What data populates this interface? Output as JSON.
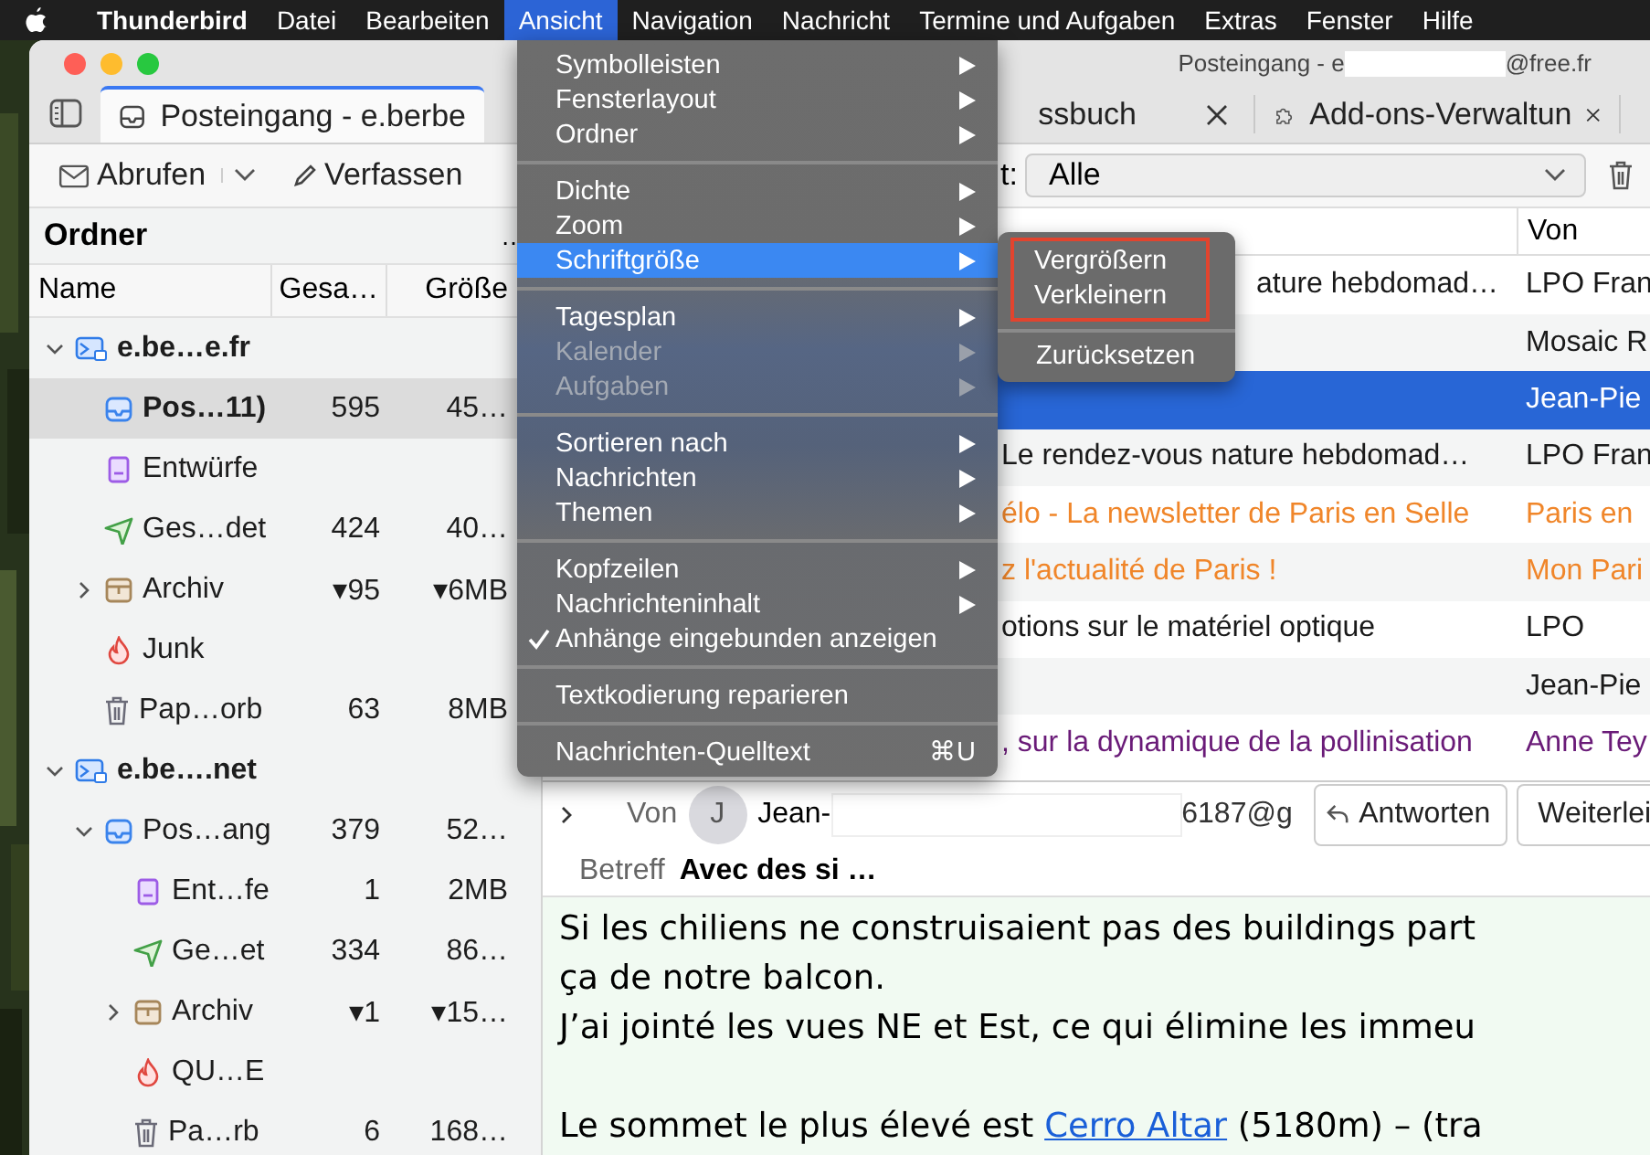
{
  "menubar": {
    "items": [
      {
        "label": "Thunderbird",
        "kind": "app",
        "selected": false
      },
      {
        "label": "Datei",
        "kind": "menu",
        "selected": false
      },
      {
        "label": "Bearbeiten",
        "kind": "menu",
        "selected": false
      },
      {
        "label": "Ansicht",
        "kind": "menu",
        "selected": true
      },
      {
        "label": "Navigation",
        "kind": "menu",
        "selected": false
      },
      {
        "label": "Nachricht",
        "kind": "menu",
        "selected": false
      },
      {
        "label": "Termine und Aufgaben",
        "kind": "menu",
        "selected": false
      },
      {
        "label": "Extras",
        "kind": "menu",
        "selected": false
      },
      {
        "label": "Fenster",
        "kind": "menu",
        "selected": false
      },
      {
        "label": "Hilfe",
        "kind": "menu",
        "selected": false
      }
    ]
  },
  "window": {
    "title_start": "Posteingang - e",
    "title_end": "@free.fr"
  },
  "tabs": [
    {
      "label": "Posteingang - e.berbe",
      "kind": "inbox",
      "selected": true,
      "closable": false
    },
    {
      "label": "ssbuch",
      "selected": false,
      "closable": true
    },
    {
      "label": "Add-ons-Verwaltun",
      "kind": "puzzle",
      "selected": false,
      "closable": true
    }
  ],
  "toolbar": {
    "get_messages": "Abrufen",
    "compose": "Verfassen",
    "filter_label": "t:",
    "filter_value": "Alle"
  },
  "folder_pane": {
    "title": "Ordner",
    "more": "…",
    "columns": [
      "Name",
      "Gesa…",
      "Größe"
    ],
    "folders": [
      {
        "name": "e.be…e.fr",
        "kind": "account",
        "bold": true,
        "selected": false,
        "expanded": true,
        "children": [
          {
            "name": "Pos…11)",
            "kind": "inbox",
            "total": "595",
            "size": "45…",
            "bold": true,
            "selected": true
          },
          {
            "name": "Entwürfe",
            "kind": "drafts",
            "bold": false,
            "selected": false
          },
          {
            "name": "Ges…det",
            "kind": "sent",
            "total": "424",
            "size": "40…",
            "bold": false,
            "selected": false
          },
          {
            "name": "Archiv",
            "kind": "archive",
            "total": "▾95",
            "size": "▾6MB",
            "bold": false,
            "selected": false,
            "expanded": false
          },
          {
            "name": "Junk",
            "kind": "junk",
            "bold": false,
            "selected": false
          },
          {
            "name": "Pap…orb",
            "kind": "trash",
            "total": "63",
            "size": "8MB",
            "bold": false,
            "selected": false
          }
        ]
      },
      {
        "name": "e.be….net",
        "kind": "account",
        "bold": true,
        "selected": false,
        "expanded": true,
        "children": [
          {
            "name": "Pos…ang",
            "kind": "inbox",
            "total": "379",
            "size": "52…",
            "bold": false,
            "selected": false,
            "expanded": true,
            "children": [
              {
                "name": "Ent…fe",
                "kind": "drafts",
                "total": "1",
                "size": "2MB",
                "bold": false,
                "selected": false
              },
              {
                "name": "Ge…et",
                "kind": "sent",
                "total": "334",
                "size": "86…",
                "bold": false,
                "selected": false
              },
              {
                "name": "Archiv",
                "kind": "archive",
                "total": "▾1",
                "size": "▾15…",
                "bold": false,
                "selected": false,
                "expanded": false
              },
              {
                "name": "QU…E",
                "kind": "junk",
                "bold": false,
                "selected": false
              },
              {
                "name": "Pa…rb",
                "kind": "trash",
                "total": "6",
                "size": "168…",
                "bold": false,
                "selected": false
              }
            ]
          }
        ]
      }
    ]
  },
  "message_list": {
    "columns": [
      "Von"
    ],
    "rows": [
      {
        "subject": "ature hebdomad…",
        "sender": "LPO Fran",
        "color": "#1a1a1a",
        "selected": false
      },
      {
        "sender": "Mosaic R",
        "color": "#1a1a1a",
        "selected": false
      },
      {
        "sender": "Jean-Pie",
        "selected": true
      },
      {
        "subject": "Le rendez-vous nature hebdomad…",
        "sender": "LPO Fran",
        "color": "#1a1a1a",
        "selected": false
      },
      {
        "subject": "élo - La newsletter de Paris en Selle",
        "sender": "Paris en",
        "color": "#f0862a",
        "selected": false
      },
      {
        "subject": "z l'actualité de Paris !",
        "sender": "Mon Pari",
        "color": "#f0862a",
        "selected": false
      },
      {
        "subject": "otions sur le matériel optique",
        "sender": "LPO",
        "color": "#1a1a1a",
        "selected": false
      },
      {
        "sender": "Jean-Pie",
        "color": "#1a1a1a",
        "selected": false
      },
      {
        "subject": ", sur la dynamique de la pollinisation",
        "sender": "Anne Tey",
        "color": "#6a1b78",
        "selected": false
      }
    ]
  },
  "message_header": {
    "from_label": "Von",
    "avatar": "J",
    "from_start": "Jean-",
    "from_end": "6187@g",
    "buttons": [
      {
        "label": "Antworten",
        "kind": "reply"
      },
      {
        "label": "Weiterlei",
        "kind": "forward"
      }
    ],
    "subject_label": "Betreff",
    "subject": "Avec des si …"
  },
  "body": {
    "paragraphs": [
      {
        "lines": [
          "Si les chiliens ne construisaient pas des buildings part",
          "ça de notre balcon.",
          "J’ai jointé les vues NE et Est, ce qui élimine les immeu"
        ]
      },
      {
        "text": "Le sommet le plus élevé est ",
        "link": "Cerro Altar",
        "after": " (5180m) – (tra"
      }
    ]
  },
  "menu": {
    "groups": [
      {
        "items": [
          {
            "label": "Symbolleisten",
            "submenu": true,
            "disabled": false,
            "checked": false,
            "selected": false
          },
          {
            "label": "Fensterlayout",
            "submenu": true,
            "disabled": false,
            "checked": false,
            "selected": false
          },
          {
            "label": "Ordner",
            "submenu": true,
            "disabled": false,
            "checked": false,
            "selected": false
          }
        ]
      },
      {
        "items": [
          {
            "label": "Dichte",
            "submenu": true,
            "disabled": false,
            "checked": false,
            "selected": false
          },
          {
            "label": "Zoom",
            "submenu": true,
            "disabled": false,
            "checked": false,
            "selected": false
          },
          {
            "label": "Schriftgröße",
            "submenu": true,
            "disabled": false,
            "checked": false,
            "selected": true
          }
        ]
      },
      {
        "items": [
          {
            "label": "Tagesplan",
            "submenu": true,
            "disabled": false,
            "checked": false,
            "selected": false
          },
          {
            "label": "Kalender",
            "submenu": true,
            "disabled": true,
            "checked": false,
            "selected": false
          },
          {
            "label": "Aufgaben",
            "submenu": true,
            "disabled": true,
            "checked": false,
            "selected": false
          }
        ]
      },
      {
        "items": [
          {
            "label": "Sortieren nach",
            "submenu": true,
            "disabled": false,
            "checked": false,
            "selected": false
          },
          {
            "label": "Nachrichten",
            "submenu": true,
            "disabled": false,
            "checked": false,
            "selected": false
          },
          {
            "label": "Themen",
            "submenu": true,
            "disabled": false,
            "checked": false,
            "selected": false
          }
        ]
      },
      {
        "items": [
          {
            "label": "Kopfzeilen",
            "submenu": true,
            "disabled": false,
            "checked": false,
            "selected": false
          },
          {
            "label": "Nachrichteninhalt",
            "submenu": true,
            "disabled": false,
            "checked": false,
            "selected": false
          },
          {
            "label": "Anhänge eingebunden anzeigen",
            "submenu": false,
            "disabled": false,
            "checked": true,
            "selected": false
          }
        ]
      },
      {
        "items": [
          {
            "label": "Textkodierung reparieren",
            "submenu": false,
            "disabled": false,
            "checked": false,
            "selected": false
          }
        ]
      },
      {
        "items": [
          {
            "label": "Nachrichten-Quelltext",
            "shortcut": "⌘U",
            "submenu": false,
            "disabled": false,
            "checked": false,
            "selected": false
          }
        ]
      }
    ]
  },
  "submenu": {
    "groups": [
      {
        "framed": true,
        "items": [
          {
            "label": "Vergrößern"
          },
          {
            "label": "Verkleinern"
          }
        ]
      },
      {
        "framed": false,
        "items": [
          {
            "label": "Zurücksetzen"
          }
        ]
      }
    ]
  }
}
